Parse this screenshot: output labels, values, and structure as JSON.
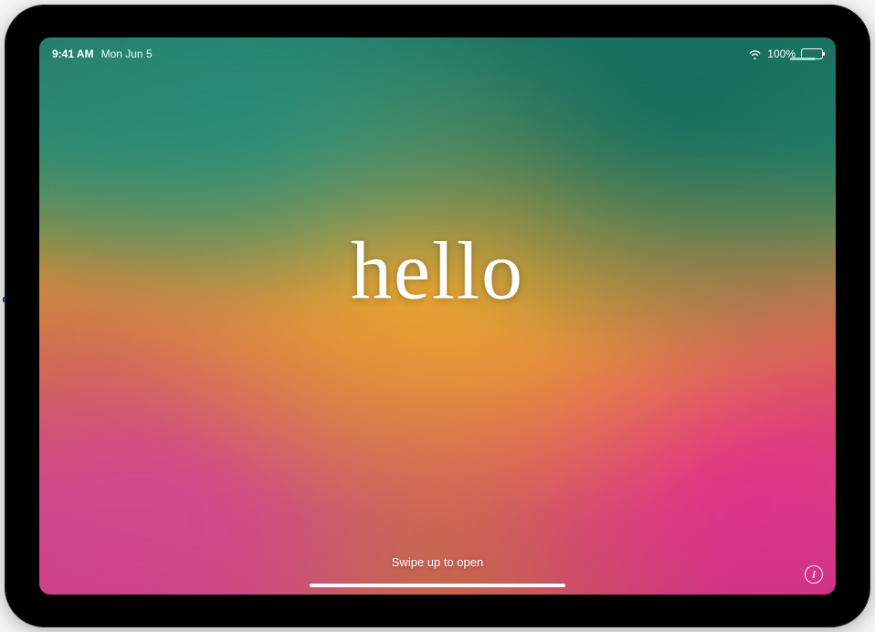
{
  "status": {
    "time": "9:41 AM",
    "date": "Mon Jun 5",
    "battery_pct": "100%",
    "wifi_icon": "wifi",
    "battery_level": 100
  },
  "greeting": {
    "text": "hello"
  },
  "hint": {
    "swipe_label": "Swipe up to open"
  },
  "info": {
    "icon_label": "i"
  }
}
